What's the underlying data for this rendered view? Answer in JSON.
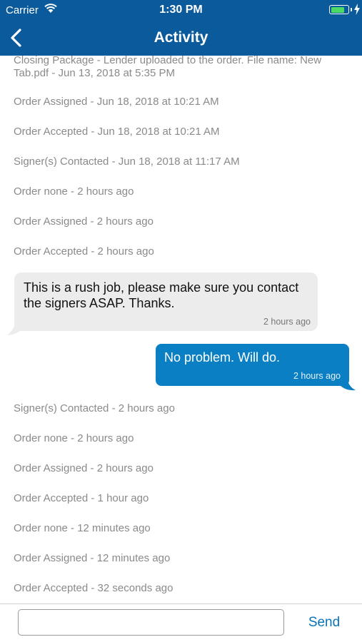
{
  "status_bar": {
    "carrier": "Carrier",
    "time": "1:30 PM",
    "battery_level": 0.85,
    "battery_color": "#4cd964"
  },
  "nav": {
    "title": "Activity",
    "back_icon": "chevron-left-icon",
    "color": "#0a5a9c"
  },
  "feed": {
    "top_items": [
      "Closing Package - Lender uploaded to the order. File name: New Tab.pdf - Jun 13, 2018 at 5:35 PM",
      "Order Assigned - Jun 18, 2018 at 10:21 AM",
      "Order Accepted - Jun 18, 2018 at 10:21 AM",
      "Signer(s) Contacted - Jun 18, 2018 at 11:17 AM",
      "Order none - 2 hours ago",
      "Order Assigned - 2 hours ago",
      "Order Accepted - 2 hours ago"
    ],
    "incoming_message": {
      "text": "This is a rush job, please make sure you contact the signers ASAP. Thanks.",
      "time": "2 hours ago"
    },
    "outgoing_message": {
      "text": "No problem. Will do.",
      "time": "2 hours ago",
      "color": "#0a7fc4"
    },
    "bottom_items": [
      "Signer(s) Contacted - 2 hours ago",
      "Order none - 2 hours ago",
      "Order Assigned - 2 hours ago",
      "Order Accepted - 1 hour ago",
      "Order none - 12 minutes ago",
      "Order Assigned - 12 minutes ago",
      "Order Accepted - 32 seconds ago"
    ]
  },
  "composer": {
    "input_value": "",
    "send_label": "Send"
  }
}
